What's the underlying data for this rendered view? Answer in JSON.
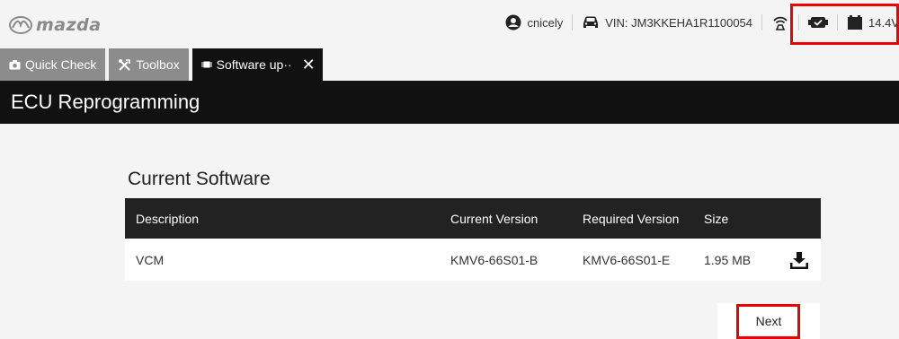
{
  "brand": {
    "name": "mazda"
  },
  "header": {
    "user": "cnicely",
    "vin": "VIN: JM3KKEHA1R1100054",
    "voltage": "14.4V"
  },
  "tabs": [
    {
      "label": "Quick Check",
      "icon": "camera-icon"
    },
    {
      "label": "Toolbox",
      "icon": "tools-icon"
    },
    {
      "label": "Software up··",
      "icon": "chip-icon",
      "close": "✕"
    }
  ],
  "page": {
    "title": "ECU Reprogramming",
    "section_title": "Current Software"
  },
  "table": {
    "headers": [
      "Description",
      "Current Version",
      "Required Version",
      "Size"
    ],
    "rows": [
      {
        "description": "VCM",
        "current": "KMV6-66S01-B",
        "required": "KMV6-66S01-E",
        "size": "1.95 MB",
        "action_icon": "download-icon"
      }
    ]
  },
  "buttons": {
    "next": "Next"
  },
  "colors": {
    "highlight": "#e00000",
    "header_bg": "#111111",
    "tab_bg": "#8c8c8c"
  }
}
